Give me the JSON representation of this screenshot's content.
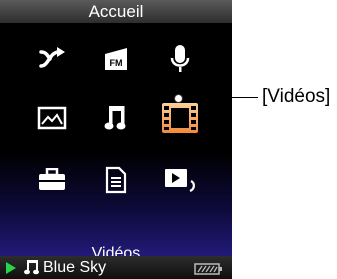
{
  "screen": {
    "title": "Accueil",
    "selected_label": "Vidéos"
  },
  "menu": {
    "icons": [
      {
        "name": "shuffle-icon"
      },
      {
        "name": "fm-radio-icon",
        "text": "FM"
      },
      {
        "name": "microphone-icon"
      },
      {
        "name": "photo-icon"
      },
      {
        "name": "music-note-icon"
      },
      {
        "name": "film-icon",
        "selected": true
      },
      {
        "name": "settings-toolbox-icon"
      },
      {
        "name": "playlist-document-icon"
      },
      {
        "name": "now-playing-icon"
      }
    ]
  },
  "status": {
    "track": "Blue Sky",
    "play_icon": "play-icon",
    "note_icon": "music-note-icon",
    "battery_icon": "battery-icon"
  },
  "callout": {
    "label": "[Vidéos]"
  },
  "colors": {
    "accent": "#f5a25a",
    "play": "#29d34a",
    "menu_gradient_bottom": "#221a78"
  }
}
